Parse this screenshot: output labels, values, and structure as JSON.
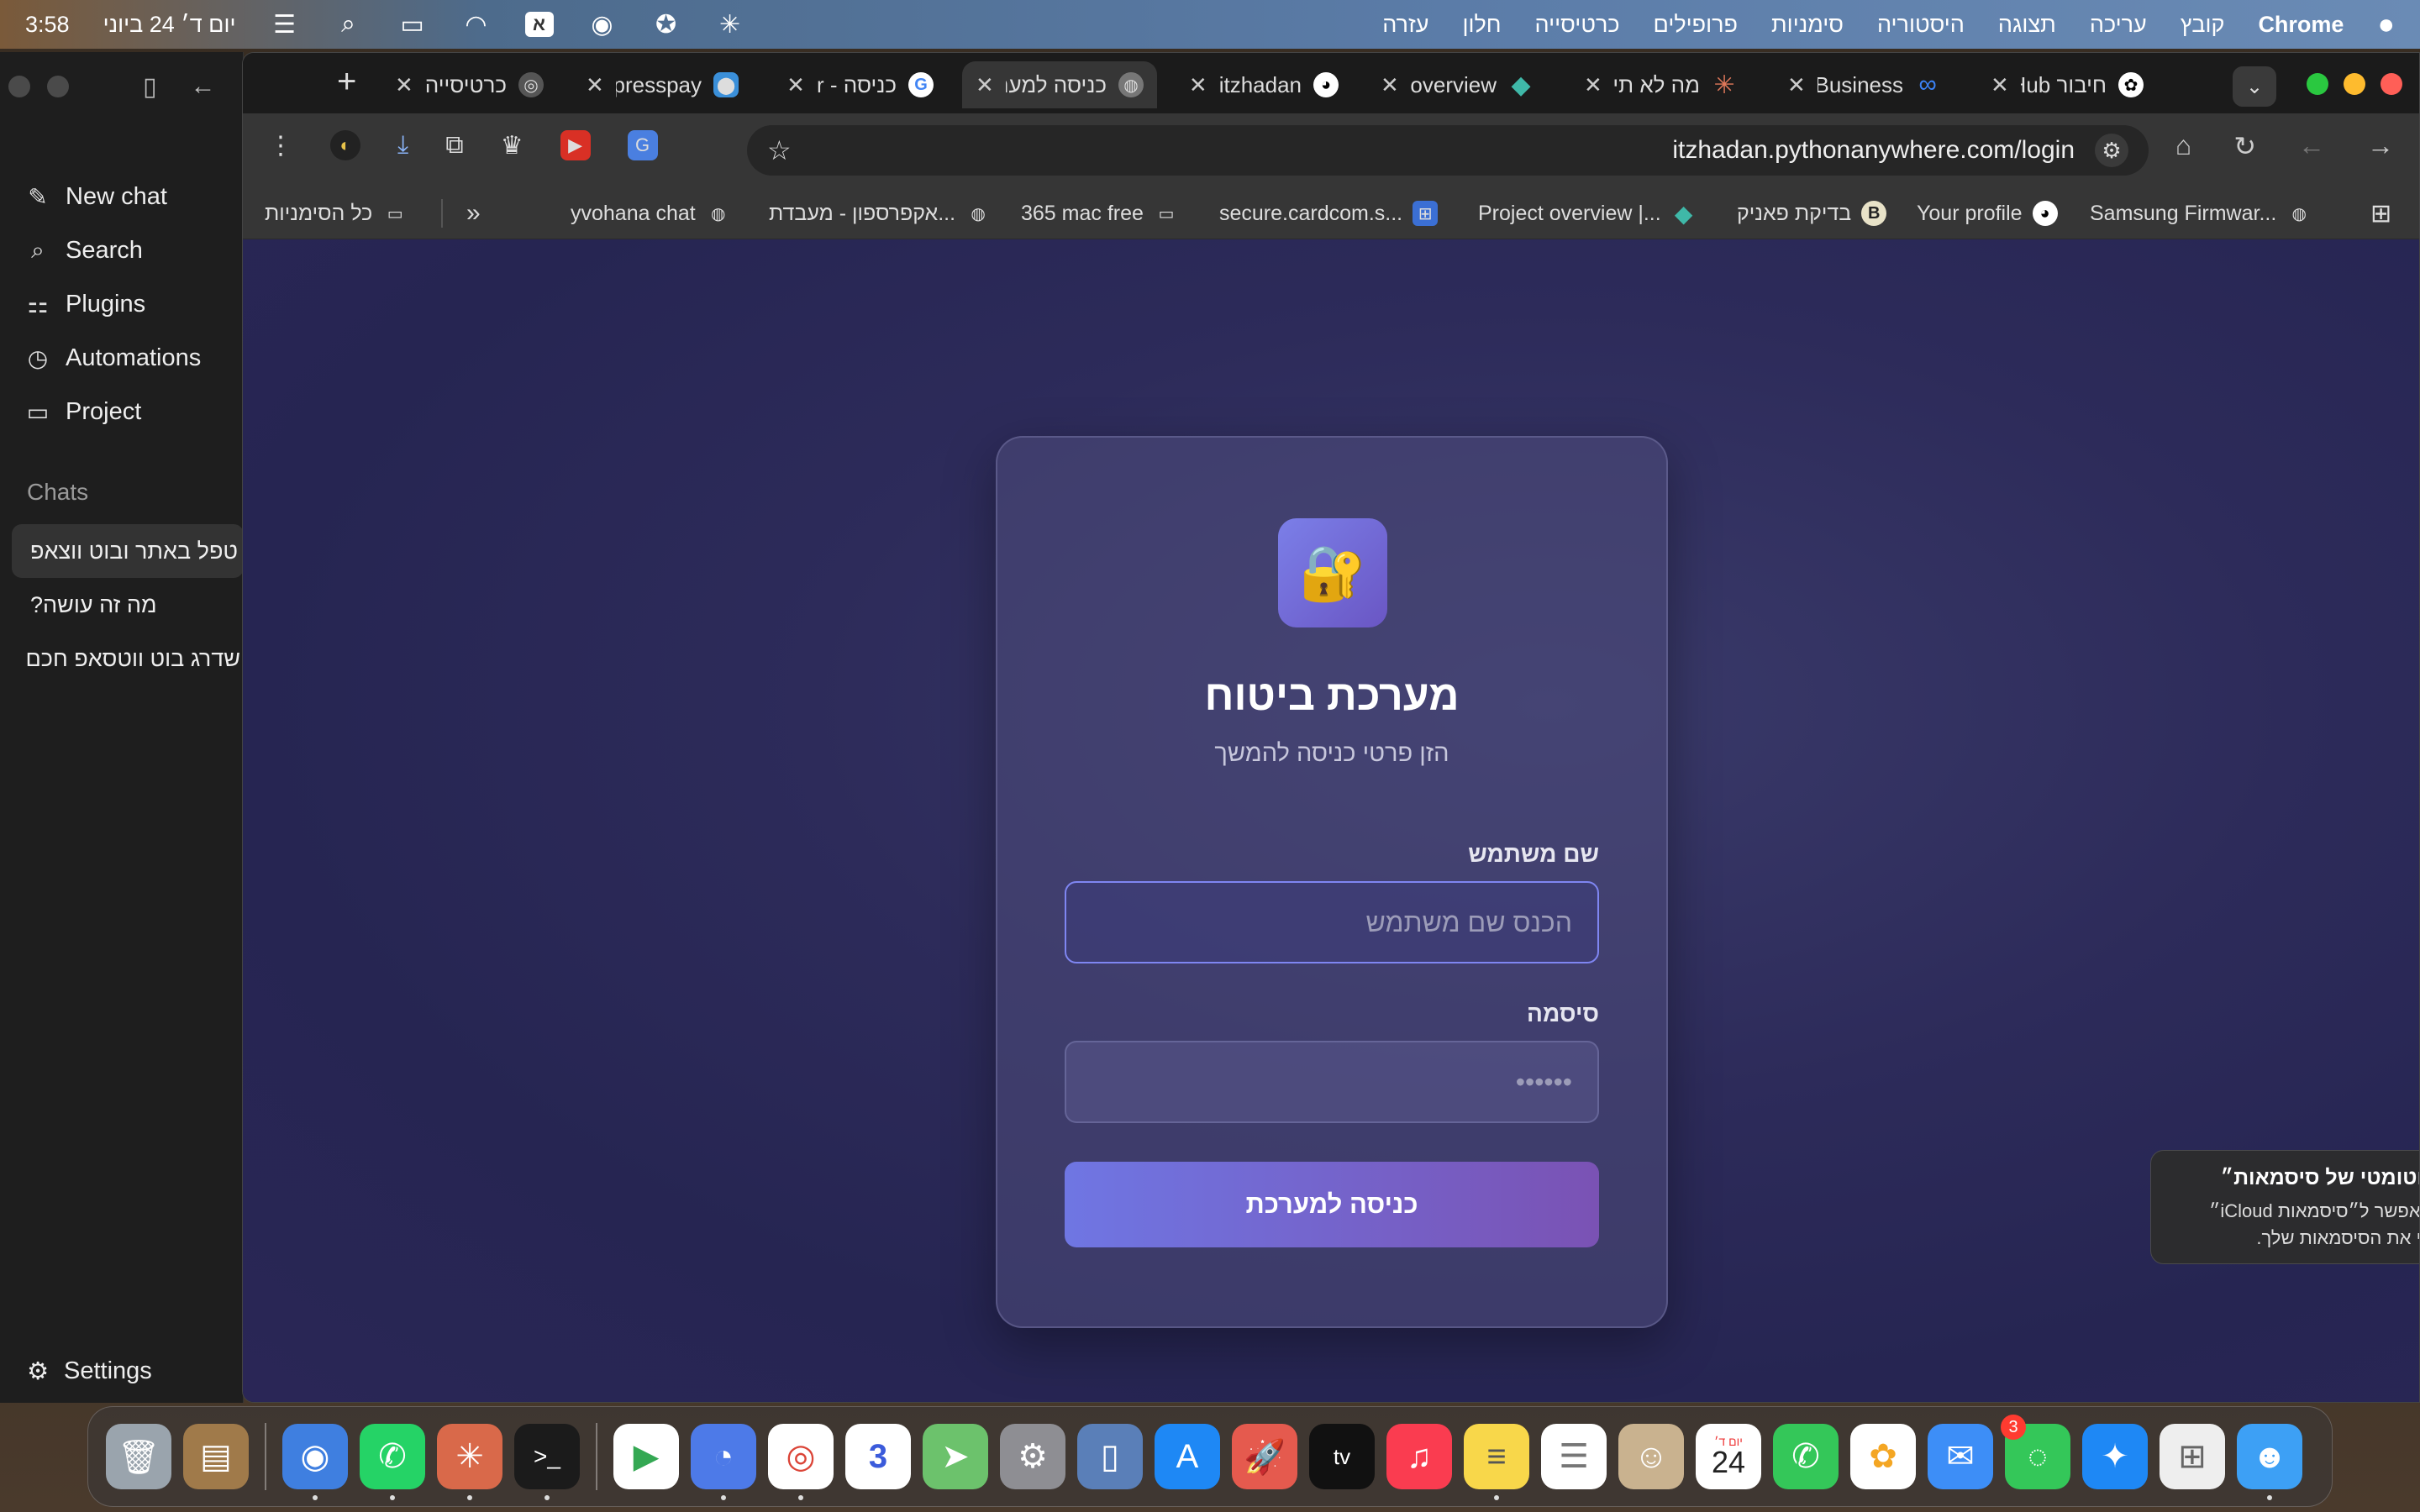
{
  "menubar": {
    "time": "3:58",
    "date": "יום ד׳ 24 ביוני",
    "input_source": "א",
    "menus": [
      "עזרה",
      "חלון",
      "כרטיסייה",
      "פרופילים",
      "סימניות",
      "היסטוריה",
      "תצוגה",
      "עריכה",
      "קובץ"
    ],
    "app_name": "Chrome"
  },
  "chat_sidebar": {
    "nav": [
      {
        "label": "New chat",
        "icon": "compose-icon"
      },
      {
        "label": "Search",
        "icon": "search-icon"
      },
      {
        "label": "Plugins",
        "icon": "plugins-grid-icon"
      },
      {
        "label": "Automations",
        "icon": "clock-icon"
      },
      {
        "label": "Project",
        "icon": "folder-icon"
      }
    ],
    "section_label": "Chats",
    "chats": [
      "טפל באתר ובוט ווצאפ",
      "מה זה עושה?",
      "שדרג בוט ווטסאפ חכם"
    ],
    "settings_label": "Settings"
  },
  "browser": {
    "tabs": [
      {
        "title": "חיבור GitHub",
        "icon": "openai-icon"
      },
      {
        "title": "Meta Business",
        "icon": "meta-icon"
      },
      {
        "title": "מה לא תי",
        "icon": "claude-icon"
      },
      {
        "title": "Project overview",
        "icon": "diamond-icon"
      },
      {
        "title": "itzhadan",
        "icon": "github-icon"
      },
      {
        "title": "כניסה למערכת",
        "icon": "globe-icon"
      },
      {
        "title": "כניסה - r",
        "icon": "google-icon"
      },
      {
        "title": "Expresspay",
        "icon": "pin-icon"
      },
      {
        "title": "כרטיסייה",
        "icon": "chrome-icon"
      }
    ],
    "url": "itzhadan.pythonanywhere.com/login",
    "bookmarks": [
      {
        "label": "Samsung Firmwar...",
        "icon": "globe-icon"
      },
      {
        "label": "Your profile",
        "icon": "github-icon"
      },
      {
        "label": "בדיקת פאניק",
        "icon": "b-icon"
      },
      {
        "label": "Project overview |...",
        "icon": "diamond-icon"
      },
      {
        "label": "secure.cardcom.s...",
        "icon": "cardcom-icon"
      },
      {
        "label": "365 mac free",
        "icon": "folder-icon"
      },
      {
        "label": "אקפרספון - מעבדת...",
        "icon": "globe-icon"
      },
      {
        "label": "yvohana chat",
        "icon": "globe-icon"
      }
    ],
    "bookmarks_overflow": "»",
    "all_bookmarks_label": "כל הסימניות"
  },
  "login": {
    "icon": "lock-key-icon",
    "title": "מערכת ביטוח",
    "subtitle": "הזן פרטי כניסה להמשך",
    "username_label": "שם משתמש",
    "username_placeholder": "הכנס שם משתמש",
    "username_value": "",
    "password_label": "סיסמה",
    "password_placeholder": "••••••",
    "password_value": "",
    "submit_label": "כניסה למערכת"
  },
  "notification": {
    "title": "הפעלת ״מילוי אוטומטי של סיסמאות״",
    "body": "ניתן ללחוץ כאן כדי לאפשר ל״סיסמאות iCloud״ למלא באופן אוטומטי את הסיסמאות שלך."
  },
  "dock": {
    "calendar_weekday": "יום ד׳",
    "calendar_day": "24",
    "messages_badge": "3",
    "apps": [
      "Trash",
      "Archive",
      "Finder-helper",
      "WhatsApp",
      "Claude",
      "Terminal",
      "Google Play",
      "Messages-AI",
      "Chrome",
      "Calculator",
      "Maps",
      "System Settings",
      "iPhone Mirroring",
      "App Store",
      "Launcher",
      "Apple TV",
      "Music",
      "Notes",
      "Reminders",
      "Contacts",
      "Calendar",
      "Phone",
      "Photos",
      "Mail",
      "Messages",
      "Safari",
      "Launchpad",
      "Finder"
    ]
  },
  "colors": {
    "page_bg": "#2d2b5a",
    "card_bg": "#4e4c7c",
    "accent_start": "#6f76e3",
    "accent_end": "#7a52b4",
    "focus_border": "#7f86f2"
  }
}
